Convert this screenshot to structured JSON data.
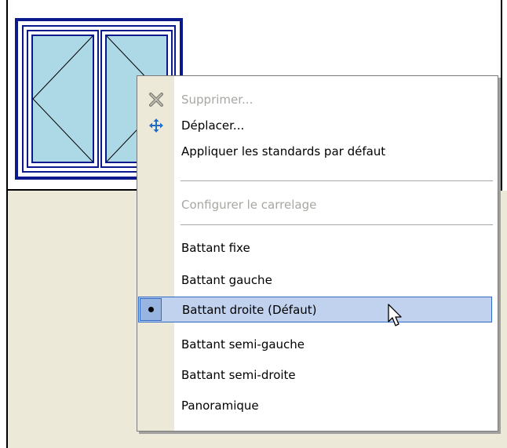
{
  "menu": {
    "items": [
      {
        "label": "Supprimer...",
        "icon": "delete-x-icon",
        "disabled": true
      },
      {
        "label": "Déplacer...",
        "icon": "move-arrows-icon",
        "disabled": false
      },
      {
        "label": "Appliquer les standards par défaut",
        "disabled": false
      },
      {
        "label": "Configurer le carrelage",
        "disabled": true
      },
      {
        "label": "Battant fixe",
        "disabled": false
      },
      {
        "label": "Battant gauche",
        "disabled": false
      },
      {
        "label": "Battant droite (Défaut)",
        "disabled": false,
        "selected": true
      },
      {
        "label": "Battant semi-gauche",
        "disabled": false
      },
      {
        "label": "Battant semi-droite",
        "disabled": false
      },
      {
        "label": "Panoramique",
        "disabled": false
      }
    ]
  },
  "colors": {
    "window_frame": "#0a1a8c",
    "glass": "#add8e6",
    "menu_gutter": "#ece9d8",
    "highlight": "#c1d2ee",
    "highlight_border": "#316ac5",
    "disabled_text": "#a8a7a2"
  }
}
